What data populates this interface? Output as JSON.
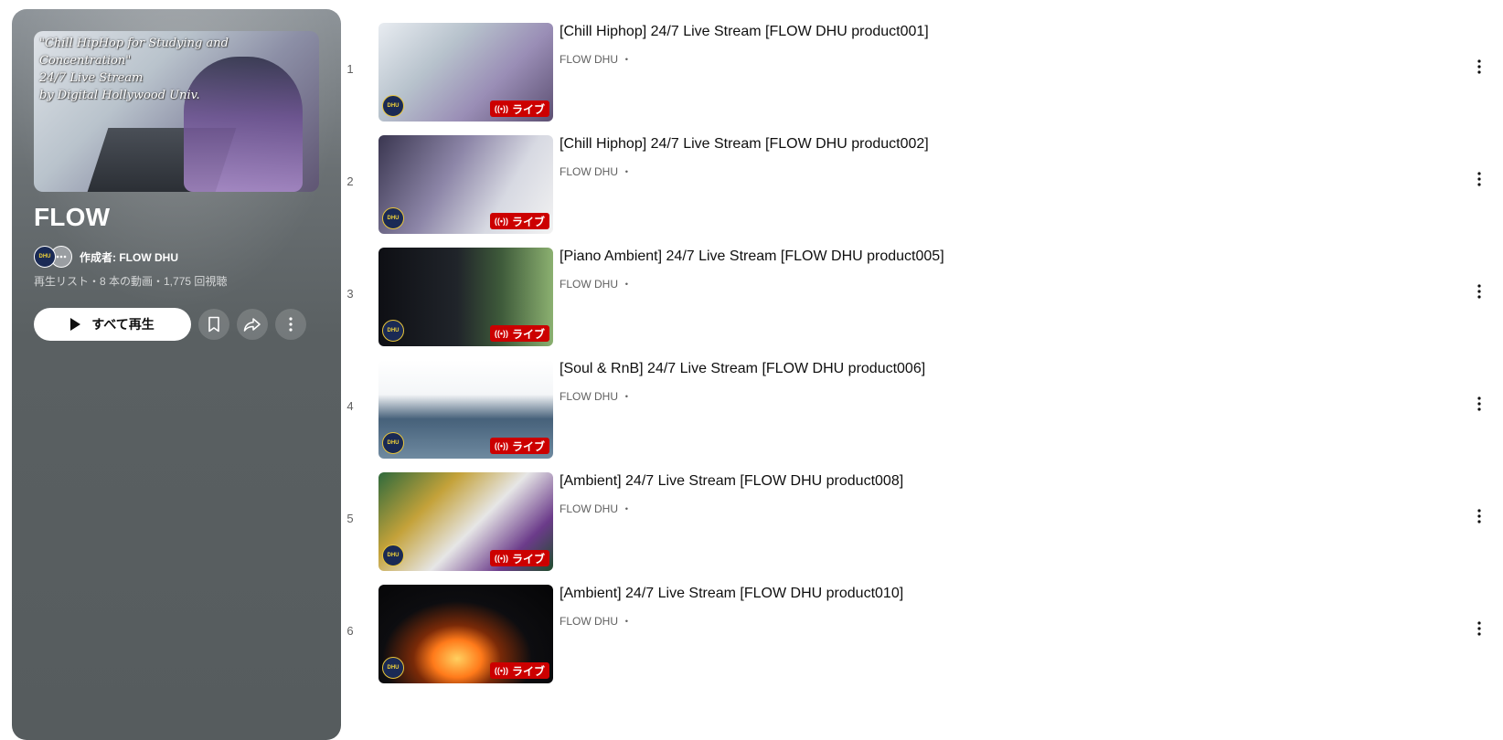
{
  "playlist": {
    "cover_text": "\"Chill HipHop for Studying and Concentration\"\n24/7 Live Stream\nby Digital Hollywood Univ.",
    "title": "FLOW",
    "owner_avatar_text": "DHU",
    "owner_label": "作成者: FLOW DHU",
    "meta": "再生リスト・8 本の動画・1,775 回視聴",
    "play_all_label": "すべて再生",
    "icons": [
      "play-icon",
      "bookmark-icon",
      "share-icon",
      "more-vert-icon"
    ]
  },
  "videos": [
    {
      "index": "1",
      "title": "[Chill Hiphop] 24/7 Live Stream [FLOW DHU product001]",
      "channel": "FLOW DHU ・",
      "badge": "ライブ",
      "logo": "DHU"
    },
    {
      "index": "2",
      "title": "[Chill Hiphop] 24/7 Live Stream [FLOW DHU product002]",
      "channel": "FLOW DHU ・",
      "badge": "ライブ",
      "logo": "DHU"
    },
    {
      "index": "3",
      "title": "[Piano Ambient] 24/7 Live Stream [FLOW DHU product005]",
      "channel": "FLOW DHU ・",
      "badge": "ライブ",
      "logo": "DHU"
    },
    {
      "index": "4",
      "title": "[Soul & RnB] 24/7 Live Stream [FLOW DHU product006]",
      "channel": "FLOW DHU ・",
      "badge": "ライブ",
      "logo": "DHU"
    },
    {
      "index": "5",
      "title": "[Ambient] 24/7 Live Stream [FLOW DHU product008]",
      "channel": "FLOW DHU ・",
      "badge": "ライブ",
      "logo": "DHU"
    },
    {
      "index": "6",
      "title": "[Ambient] 24/7 Live Stream [FLOW DHU product010]",
      "channel": "FLOW DHU ・",
      "badge": "ライブ",
      "logo": "DHU"
    }
  ],
  "colors": {
    "live_badge": "#cc0000",
    "panel_bg": "#5a6062",
    "text_primary": "#0f0f0f",
    "text_secondary": "#606060"
  }
}
